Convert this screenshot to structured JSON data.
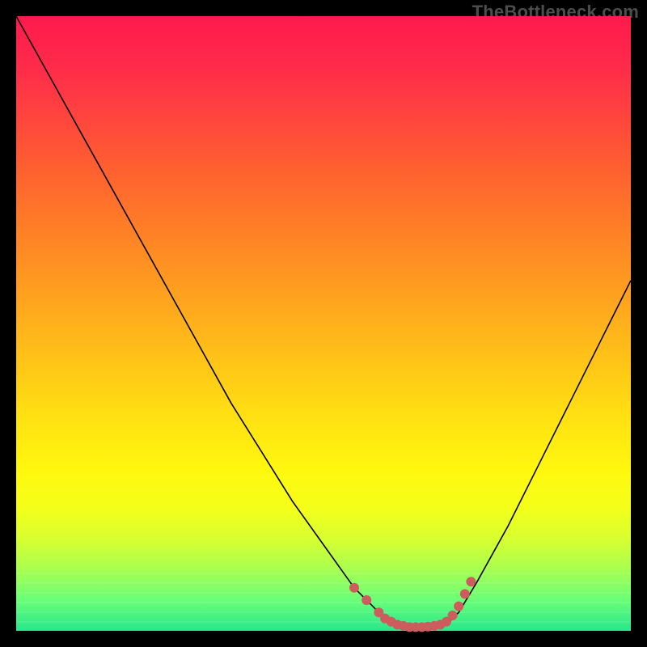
{
  "brand": "TheBottleneck.com",
  "colors": {
    "frame": "#000000",
    "marker": "#cd5c5c",
    "line": "#000000"
  },
  "chart_data": {
    "type": "line",
    "title": "",
    "xlabel": "",
    "ylabel": "",
    "xlim": [
      0,
      100
    ],
    "ylim": [
      0,
      100
    ],
    "grid": false,
    "legend": false,
    "series": [
      {
        "name": "bottleneck-curve",
        "x": [
          0,
          5,
          10,
          15,
          20,
          25,
          30,
          35,
          40,
          45,
          50,
          55,
          58,
          60,
          62,
          64,
          66,
          68,
          70,
          72,
          75,
          80,
          85,
          90,
          95,
          100
        ],
        "y": [
          100,
          91,
          82,
          73,
          64,
          55,
          46,
          37,
          29,
          21,
          14,
          7,
          4,
          2,
          1,
          0.5,
          0.5,
          0.5,
          1,
          3,
          8,
          17,
          27,
          37,
          47,
          57
        ]
      }
    ],
    "markers": {
      "name": "highlight-dots",
      "x": [
        55,
        57,
        59,
        60,
        61,
        62,
        63,
        64,
        65,
        66,
        67,
        68,
        69,
        70,
        71,
        72,
        73,
        74
      ],
      "y": [
        7,
        5,
        3,
        2,
        1.5,
        1,
        0.8,
        0.6,
        0.6,
        0.6,
        0.7,
        0.8,
        1,
        1.5,
        2.5,
        4,
        6,
        8
      ]
    }
  }
}
